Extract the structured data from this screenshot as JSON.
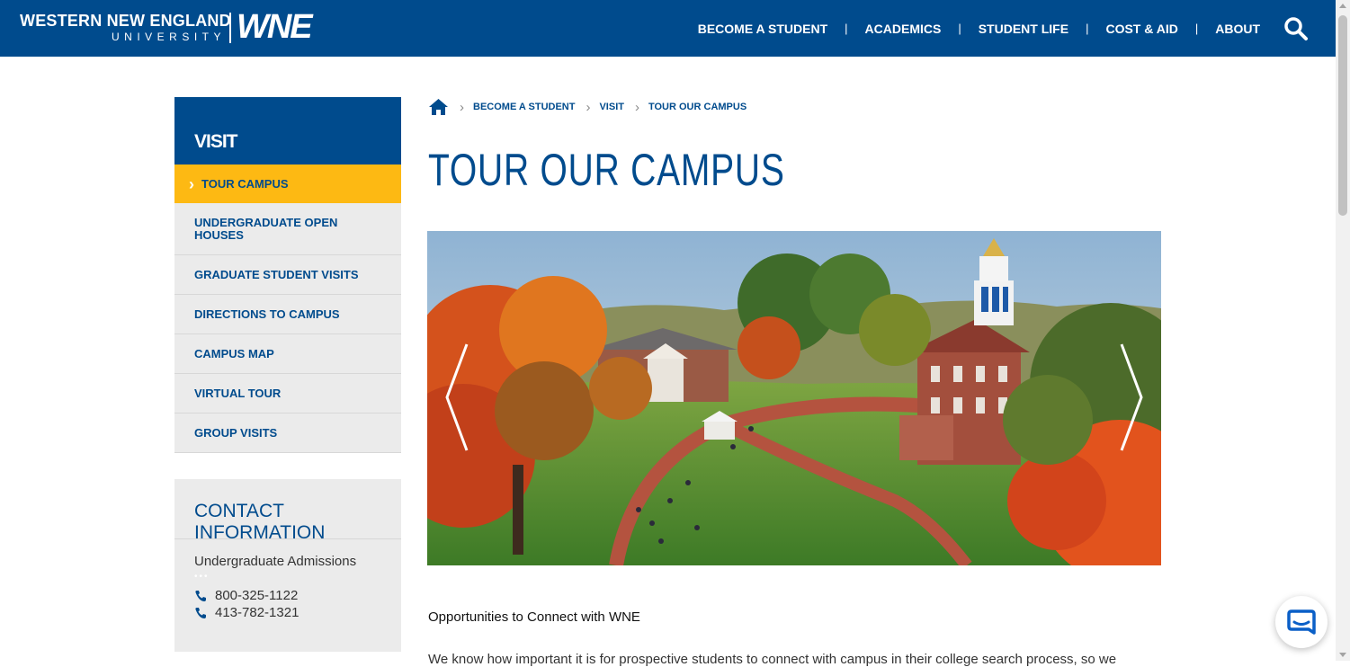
{
  "header": {
    "logo_line1": "WESTERN NEW ENGLAND",
    "logo_line2": "UNIVERSITY",
    "logo_mark": "WNE",
    "nav": [
      "BECOME A STUDENT",
      "ACADEMICS",
      "STUDENT LIFE",
      "COST & AID",
      "ABOUT"
    ],
    "nav_separator": "|",
    "search_icon": "search-icon"
  },
  "sidebar": {
    "heading": "VISIT",
    "items": [
      {
        "label": "TOUR CAMPUS",
        "active": true
      },
      {
        "label": "UNDERGRADUATE OPEN HOUSES",
        "active": false
      },
      {
        "label": "GRADUATE STUDENT VISITS",
        "active": false
      },
      {
        "label": "DIRECTIONS TO CAMPUS",
        "active": false
      },
      {
        "label": "CAMPUS MAP",
        "active": false
      },
      {
        "label": "VIRTUAL TOUR",
        "active": false
      },
      {
        "label": "GROUP VISITS",
        "active": false
      }
    ]
  },
  "contact": {
    "heading": "CONTACT INFORMATION",
    "office": "Undergraduate Admissions",
    "phones": [
      "800-325-1122",
      "413-782-1321"
    ]
  },
  "breadcrumb": {
    "home_icon": "home-icon",
    "items": [
      "BECOME A STUDENT",
      "VISIT",
      "TOUR OUR CAMPUS"
    ]
  },
  "main": {
    "title": "TOUR OUR CAMPUS",
    "subheading": "Opportunities to Connect with WNE",
    "body": "We know how important it is for prospective students to connect with campus in their college search process, so we"
  },
  "colors": {
    "brand_blue": "#004b8d",
    "accent_gold": "#fdb913",
    "sidebar_gray": "#ebebeb"
  }
}
